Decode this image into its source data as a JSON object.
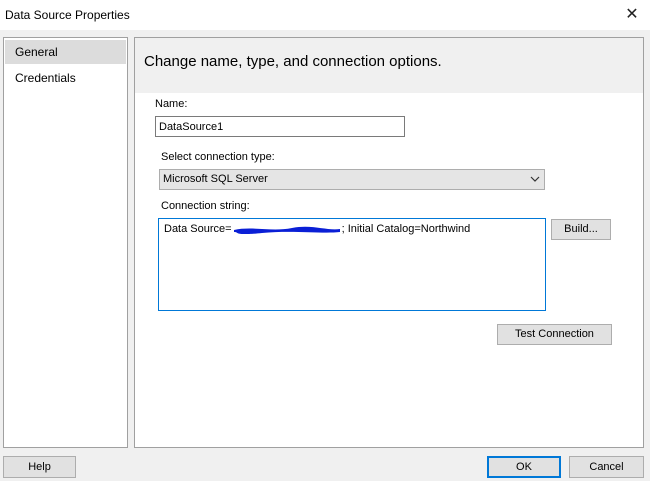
{
  "window": {
    "title": "Data Source Properties",
    "close_glyph": "✕"
  },
  "nav": {
    "items": [
      {
        "label": "General",
        "selected": true
      },
      {
        "label": "Credentials",
        "selected": false
      }
    ]
  },
  "content": {
    "header": "Change name, type, and connection options.",
    "name_label": "Name:",
    "name_value": "DataSource1",
    "connection_type_label": "Select connection type:",
    "connection_type_value": "Microsoft SQL Server",
    "connection_string_label": "Connection string:",
    "connection_string_prefix": "Data Source=",
    "connection_string_suffix": "; Initial Catalog=Northwind",
    "redaction_color": "#0a1fd6",
    "build_label": "Build...",
    "test_connection_label": "Test Connection"
  },
  "footer": {
    "help_label": "Help",
    "ok_label": "OK",
    "cancel_label": "Cancel"
  },
  "colors": {
    "accent": "#0078d7",
    "selected_nav": "#dcdcdc"
  }
}
